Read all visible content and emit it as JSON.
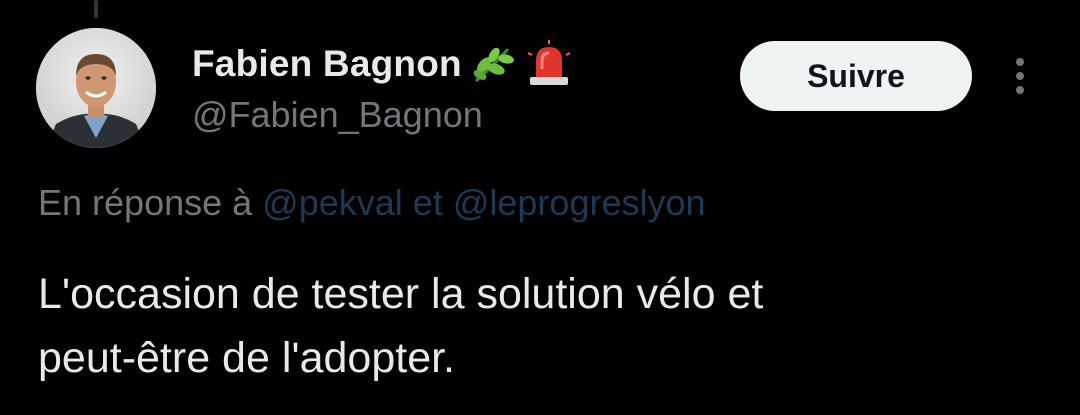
{
  "author": {
    "display_name": "Fabien Bagnon",
    "handle": "@Fabien_Bagnon",
    "badges": [
      "herb-icon",
      "police-light-icon"
    ]
  },
  "actions": {
    "follow_label": "Suivre",
    "more_icon": "more-vertical-icon"
  },
  "reply_context": {
    "prefix": "En réponse à",
    "mention_1": "@pekval",
    "connector": "et",
    "mention_2": "@leprogreslyon"
  },
  "tweet": {
    "line_1": "L'occasion de tester la solution vélo et",
    "line_2": "peut-être de l'adopter."
  },
  "colors": {
    "background": "#000000",
    "primary_text": "#e7e9ea",
    "secondary_text": "#71767b",
    "mention_dim": "#1d3a55",
    "button_bg": "#eff3f4"
  }
}
